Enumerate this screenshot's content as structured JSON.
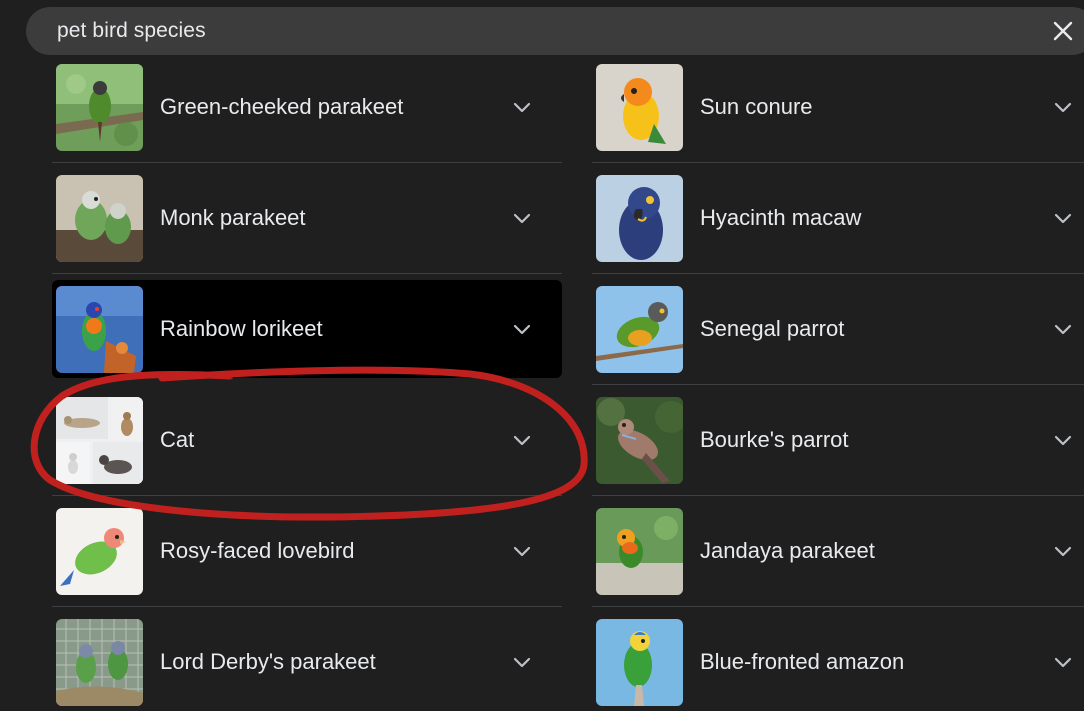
{
  "search": {
    "query": "pet bird species"
  },
  "results": {
    "left": [
      {
        "label": "Green-cheeked parakeet",
        "image": "green-cheeked-parakeet-photo"
      },
      {
        "label": "Monk parakeet",
        "image": "monk-parakeet-photo"
      },
      {
        "label": "Rainbow lorikeet",
        "image": "rainbow-lorikeet-photo"
      },
      {
        "label": "Cat",
        "image": "cat-photo-collage"
      },
      {
        "label": "Rosy-faced lovebird",
        "image": "rosy-faced-lovebird-photo"
      },
      {
        "label": "Lord Derby's parakeet",
        "image": "lord-derbys-parakeet-photo"
      }
    ],
    "right": [
      {
        "label": "Sun conure",
        "image": "sun-conure-photo"
      },
      {
        "label": "Hyacinth macaw",
        "image": "hyacinth-macaw-photo"
      },
      {
        "label": "Senegal parrot",
        "image": "senegal-parrot-photo"
      },
      {
        "label": "Bourke's parrot",
        "image": "bourkes-parrot-photo"
      },
      {
        "label": "Jandaya parakeet",
        "image": "jandaya-parakeet-photo"
      },
      {
        "label": "Blue-fronted amazon",
        "image": "blue-fronted-amazon-photo"
      }
    ]
  },
  "icons": {
    "clear": "close-icon",
    "expand": "chevron-down-icon"
  },
  "colors": {
    "background": "#1f1f1f",
    "search_bar": "#3c3c3c",
    "text": "#e8eaed",
    "divider": "#3c4043",
    "hover_row": "#000000",
    "annotation": "#c0201e"
  }
}
